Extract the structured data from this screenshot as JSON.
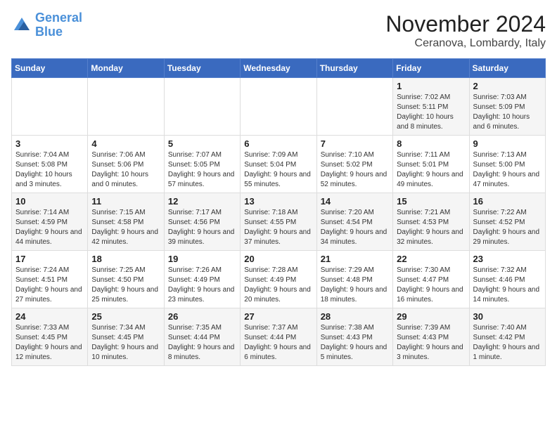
{
  "header": {
    "logo_line1": "General",
    "logo_line2": "Blue",
    "title": "November 2024",
    "subtitle": "Ceranova, Lombardy, Italy"
  },
  "weekdays": [
    "Sunday",
    "Monday",
    "Tuesday",
    "Wednesday",
    "Thursday",
    "Friday",
    "Saturday"
  ],
  "weeks": [
    [
      {
        "day": "",
        "info": ""
      },
      {
        "day": "",
        "info": ""
      },
      {
        "day": "",
        "info": ""
      },
      {
        "day": "",
        "info": ""
      },
      {
        "day": "",
        "info": ""
      },
      {
        "day": "1",
        "info": "Sunrise: 7:02 AM\nSunset: 5:11 PM\nDaylight: 10 hours and 8 minutes."
      },
      {
        "day": "2",
        "info": "Sunrise: 7:03 AM\nSunset: 5:09 PM\nDaylight: 10 hours and 6 minutes."
      }
    ],
    [
      {
        "day": "3",
        "info": "Sunrise: 7:04 AM\nSunset: 5:08 PM\nDaylight: 10 hours and 3 minutes."
      },
      {
        "day": "4",
        "info": "Sunrise: 7:06 AM\nSunset: 5:06 PM\nDaylight: 10 hours and 0 minutes."
      },
      {
        "day": "5",
        "info": "Sunrise: 7:07 AM\nSunset: 5:05 PM\nDaylight: 9 hours and 57 minutes."
      },
      {
        "day": "6",
        "info": "Sunrise: 7:09 AM\nSunset: 5:04 PM\nDaylight: 9 hours and 55 minutes."
      },
      {
        "day": "7",
        "info": "Sunrise: 7:10 AM\nSunset: 5:02 PM\nDaylight: 9 hours and 52 minutes."
      },
      {
        "day": "8",
        "info": "Sunrise: 7:11 AM\nSunset: 5:01 PM\nDaylight: 9 hours and 49 minutes."
      },
      {
        "day": "9",
        "info": "Sunrise: 7:13 AM\nSunset: 5:00 PM\nDaylight: 9 hours and 47 minutes."
      }
    ],
    [
      {
        "day": "10",
        "info": "Sunrise: 7:14 AM\nSunset: 4:59 PM\nDaylight: 9 hours and 44 minutes."
      },
      {
        "day": "11",
        "info": "Sunrise: 7:15 AM\nSunset: 4:58 PM\nDaylight: 9 hours and 42 minutes."
      },
      {
        "day": "12",
        "info": "Sunrise: 7:17 AM\nSunset: 4:56 PM\nDaylight: 9 hours and 39 minutes."
      },
      {
        "day": "13",
        "info": "Sunrise: 7:18 AM\nSunset: 4:55 PM\nDaylight: 9 hours and 37 minutes."
      },
      {
        "day": "14",
        "info": "Sunrise: 7:20 AM\nSunset: 4:54 PM\nDaylight: 9 hours and 34 minutes."
      },
      {
        "day": "15",
        "info": "Sunrise: 7:21 AM\nSunset: 4:53 PM\nDaylight: 9 hours and 32 minutes."
      },
      {
        "day": "16",
        "info": "Sunrise: 7:22 AM\nSunset: 4:52 PM\nDaylight: 9 hours and 29 minutes."
      }
    ],
    [
      {
        "day": "17",
        "info": "Sunrise: 7:24 AM\nSunset: 4:51 PM\nDaylight: 9 hours and 27 minutes."
      },
      {
        "day": "18",
        "info": "Sunrise: 7:25 AM\nSunset: 4:50 PM\nDaylight: 9 hours and 25 minutes."
      },
      {
        "day": "19",
        "info": "Sunrise: 7:26 AM\nSunset: 4:49 PM\nDaylight: 9 hours and 23 minutes."
      },
      {
        "day": "20",
        "info": "Sunrise: 7:28 AM\nSunset: 4:49 PM\nDaylight: 9 hours and 20 minutes."
      },
      {
        "day": "21",
        "info": "Sunrise: 7:29 AM\nSunset: 4:48 PM\nDaylight: 9 hours and 18 minutes."
      },
      {
        "day": "22",
        "info": "Sunrise: 7:30 AM\nSunset: 4:47 PM\nDaylight: 9 hours and 16 minutes."
      },
      {
        "day": "23",
        "info": "Sunrise: 7:32 AM\nSunset: 4:46 PM\nDaylight: 9 hours and 14 minutes."
      }
    ],
    [
      {
        "day": "24",
        "info": "Sunrise: 7:33 AM\nSunset: 4:45 PM\nDaylight: 9 hours and 12 minutes."
      },
      {
        "day": "25",
        "info": "Sunrise: 7:34 AM\nSunset: 4:45 PM\nDaylight: 9 hours and 10 minutes."
      },
      {
        "day": "26",
        "info": "Sunrise: 7:35 AM\nSunset: 4:44 PM\nDaylight: 9 hours and 8 minutes."
      },
      {
        "day": "27",
        "info": "Sunrise: 7:37 AM\nSunset: 4:44 PM\nDaylight: 9 hours and 6 minutes."
      },
      {
        "day": "28",
        "info": "Sunrise: 7:38 AM\nSunset: 4:43 PM\nDaylight: 9 hours and 5 minutes."
      },
      {
        "day": "29",
        "info": "Sunrise: 7:39 AM\nSunset: 4:43 PM\nDaylight: 9 hours and 3 minutes."
      },
      {
        "day": "30",
        "info": "Sunrise: 7:40 AM\nSunset: 4:42 PM\nDaylight: 9 hours and 1 minute."
      }
    ]
  ]
}
